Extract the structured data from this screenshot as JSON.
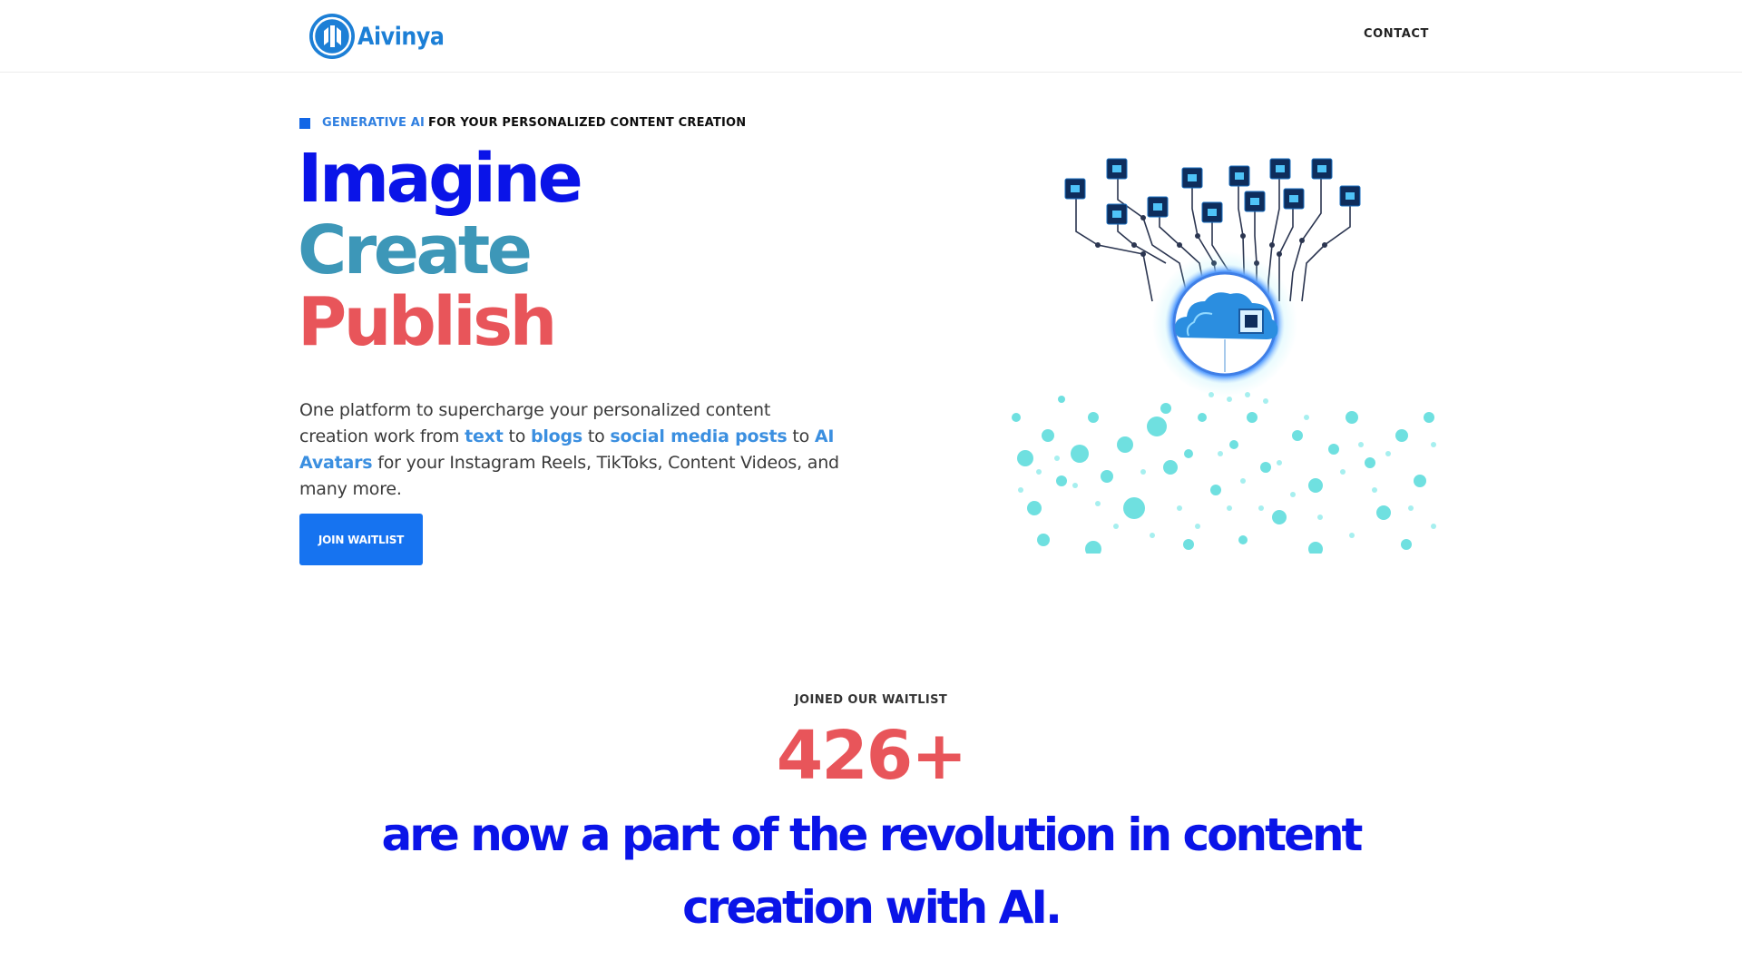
{
  "header": {
    "logo_text": "Aivinya",
    "logo_icon": "aivinya-shield-logo-icon",
    "nav": {
      "contact_label": "CONTACT"
    }
  },
  "hero": {
    "eyebrow": {
      "accent": "GENERATIVE AI",
      "rest": "FOR YOUR PERSONALIZED CONTENT CREATION"
    },
    "headline": {
      "line1": "Imagine",
      "line2": "Create",
      "line3": "Publish"
    },
    "lead": {
      "part1": "One platform to supercharge your personalized content creation work from ",
      "hl_text": "text",
      "to1": " to ",
      "hl_blogs": "blogs",
      "to2": " to ",
      "hl_social": "social media posts",
      "to3": " to ",
      "hl_avatars": "AI Avatars",
      "part2": " for your Instagram Reels, TikToks, Content Videos, and many more."
    },
    "cta_label": "JOIN WAITLIST",
    "illustration_icon": "ai-cloud-network-illustration"
  },
  "stats": {
    "label": "JOINED OUR WAITLIST",
    "number": "426+",
    "text": "are now a part of the revolution in content creation with AI."
  },
  "colors": {
    "brand_blue": "#1c7fd6",
    "headline_blue": "#0a14e8",
    "teal": "#3d97b8",
    "coral": "#e8555a",
    "cta_blue": "#1673f0",
    "link_blue": "#3b8fe0"
  }
}
